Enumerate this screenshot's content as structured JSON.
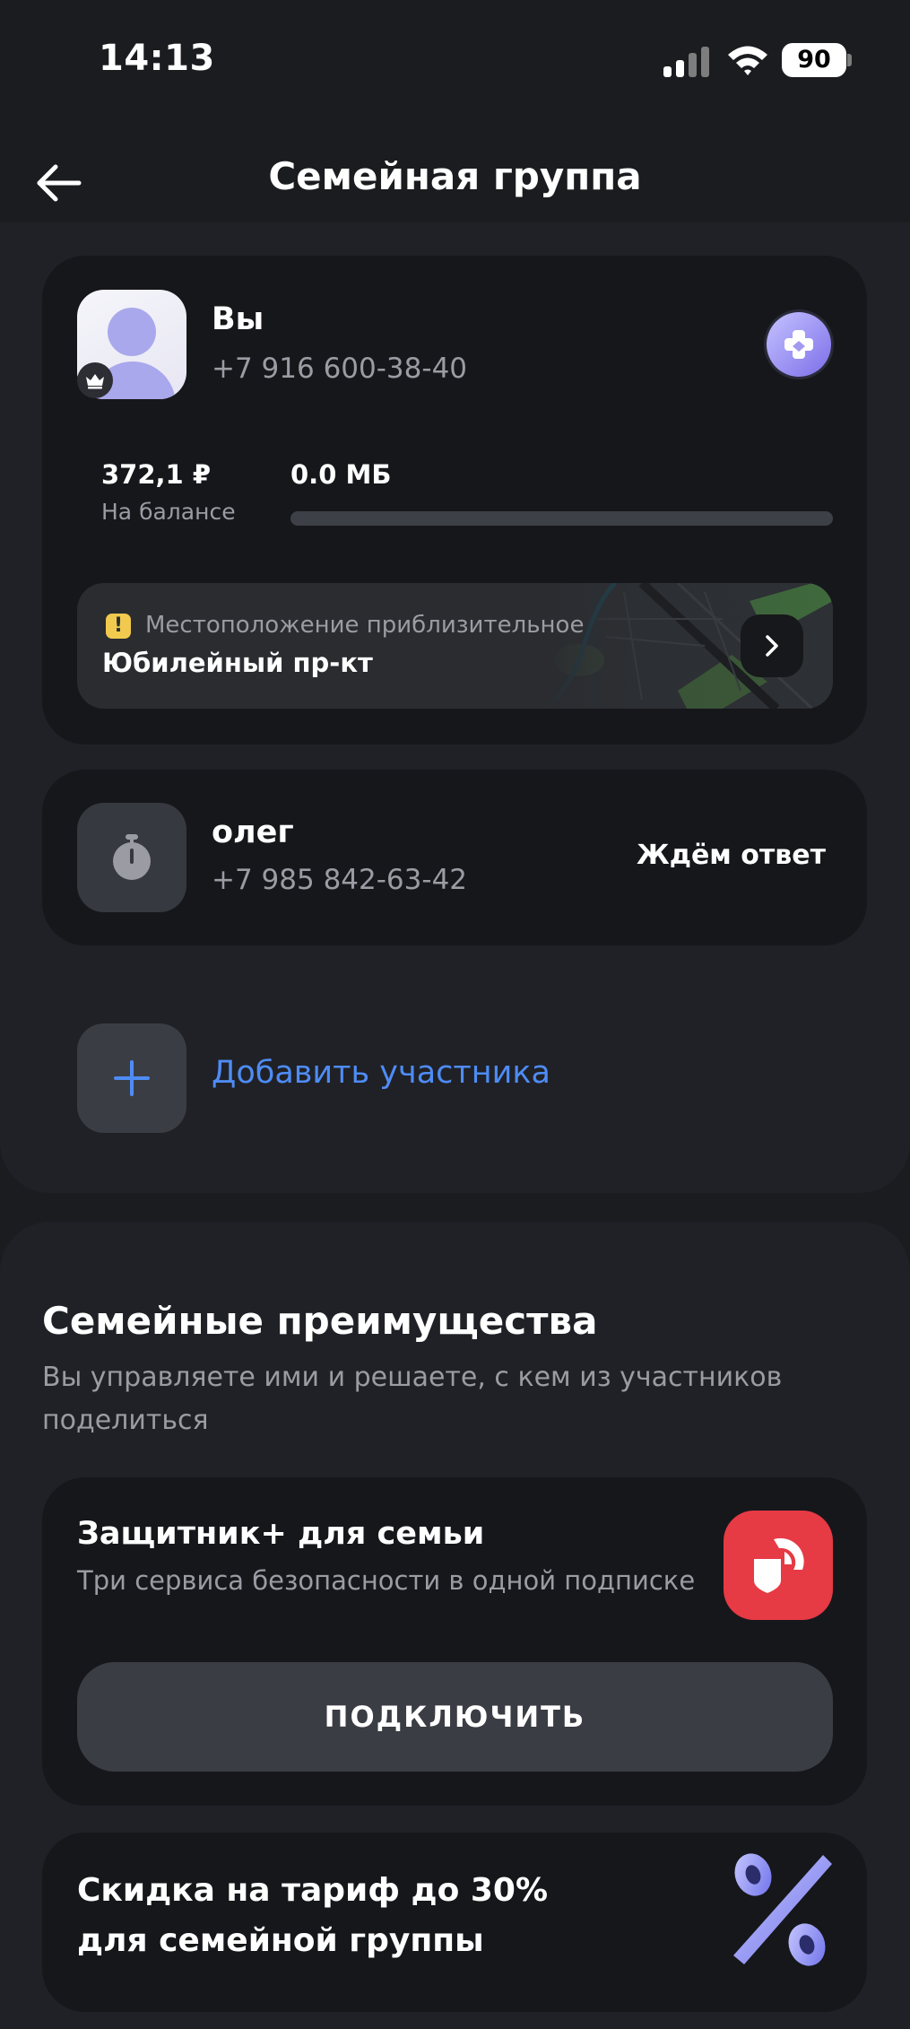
{
  "status_bar": {
    "time": "14:13",
    "battery": "90"
  },
  "header": {
    "title": "Семейная группа",
    "back_icon": "arrow-left-icon"
  },
  "owner": {
    "name": "Вы",
    "phone": "+7 916 600-38-40",
    "balance_value": "372,1 ₽",
    "balance_label": "На балансе",
    "traffic_value": "0.0 МБ",
    "traffic_fraction": 0,
    "location": {
      "hint": "Местоположение приблизительное",
      "name": "Юбилейный пр-кт"
    }
  },
  "invited_member": {
    "name": "олег",
    "phone": "+7 985 842-63-42",
    "status": "Ждём ответ"
  },
  "add_member": {
    "label": "Добавить участника"
  },
  "benefits": {
    "title": "Семейные преимущества",
    "description": "Вы управляете ими и решаете, с кем из участников поделиться",
    "protector": {
      "title": "Защитник+ для семьи",
      "description": "Три сервиса безопасности в одной подписке",
      "button": "подключить"
    },
    "discount": {
      "title": "Скидка на тариф до 30% для семейной группы"
    }
  },
  "colors": {
    "background": "#1b1c20",
    "panel": "#202126",
    "card": "#16171b",
    "accent_blue": "#4e8cf5",
    "protector_red": "#e63a44",
    "warning_yellow": "#f1c94e",
    "avatar_purple": "#a9a8ec"
  }
}
